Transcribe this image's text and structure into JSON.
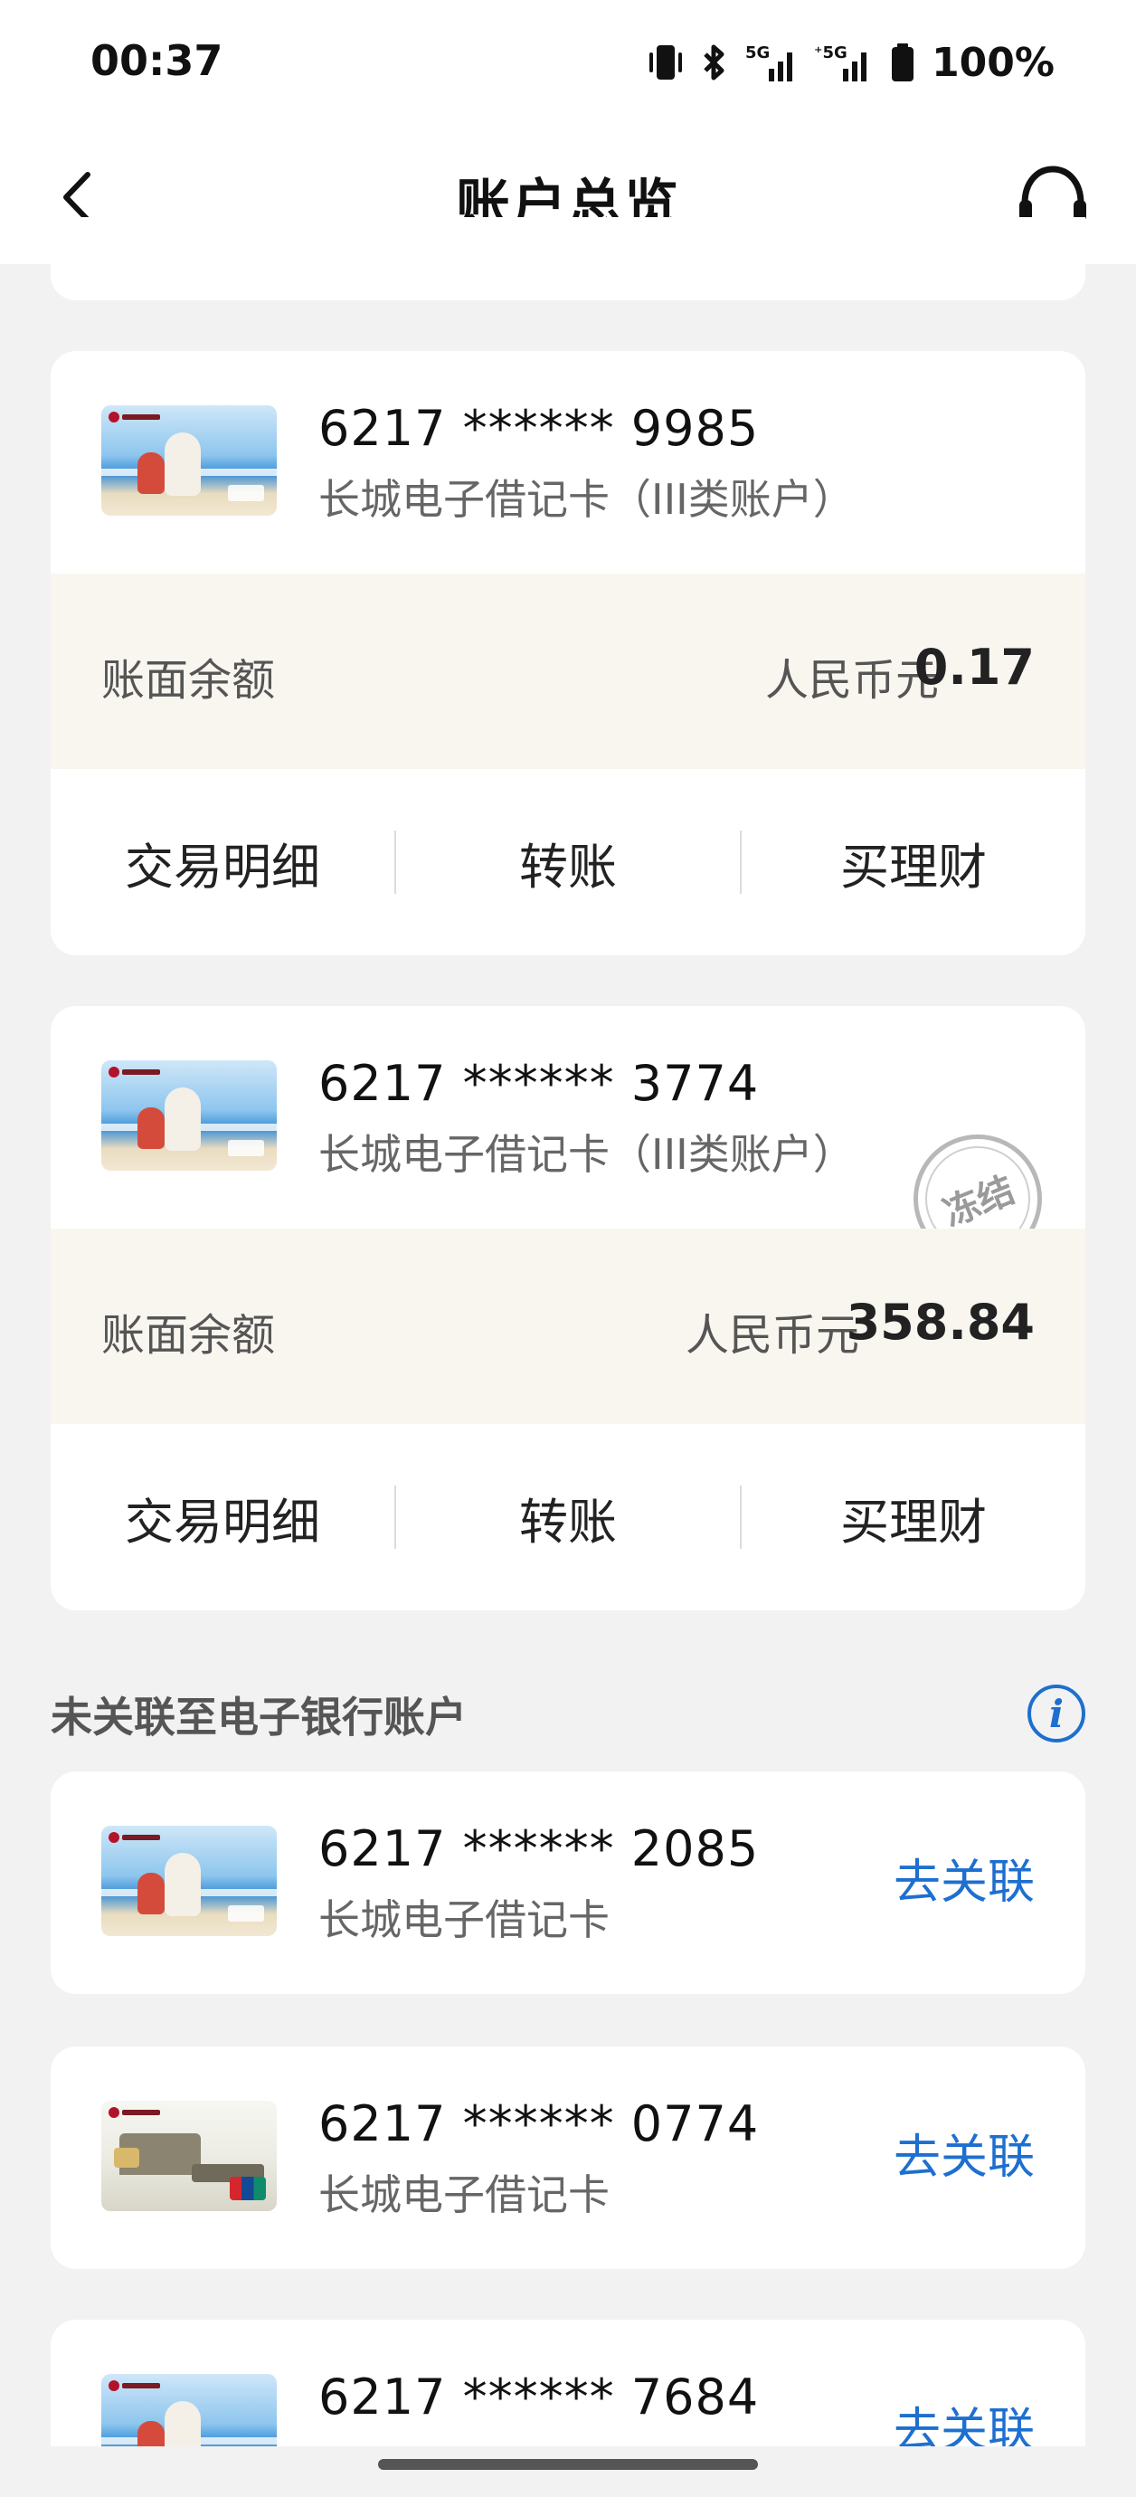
{
  "status_bar": {
    "time": "00:37",
    "battery": "100%",
    "icons": [
      "vibrate-icon",
      "bluetooth-icon",
      "signal-5g-icon",
      "signal-5g-icon",
      "battery-icon"
    ]
  },
  "header": {
    "title": "账户总览",
    "back_icon": "chevron-left-icon",
    "support_icon": "headset-icon"
  },
  "linked_accounts": [
    {
      "number": "6217 ****** 9985",
      "type": "长城电子借记卡（III类账户）",
      "balance_label": "账面余额",
      "currency": "人民币元",
      "balance": "0.17",
      "frozen": false,
      "actions": [
        "交易明细",
        "转账",
        "买理财"
      ]
    },
    {
      "number": "6217 ****** 3774",
      "type": "长城电子借记卡（III类账户）",
      "balance_label": "账面余额",
      "currency": "人民币元",
      "balance": "358.84",
      "frozen": true,
      "frozen_label": "冻结",
      "actions": [
        "交易明细",
        "转账",
        "买理财"
      ]
    }
  ],
  "unlinked_section": {
    "title": "未关联至电子银行账户",
    "info_icon": "info-icon",
    "info_glyph": "i",
    "accounts": [
      {
        "number": "6217 ****** 2085",
        "type": "长城电子借记卡",
        "action": "去关联"
      },
      {
        "number": "6217 ****** 0774",
        "type": "长城电子借记卡",
        "action": "去关联"
      },
      {
        "number": "6217 ****** 7684",
        "type": "",
        "action": "去关联"
      }
    ]
  },
  "colors": {
    "accent": "#1d6fd0",
    "balance_bg": "#f9f6f0",
    "page_bg": "#f2f2f2"
  }
}
